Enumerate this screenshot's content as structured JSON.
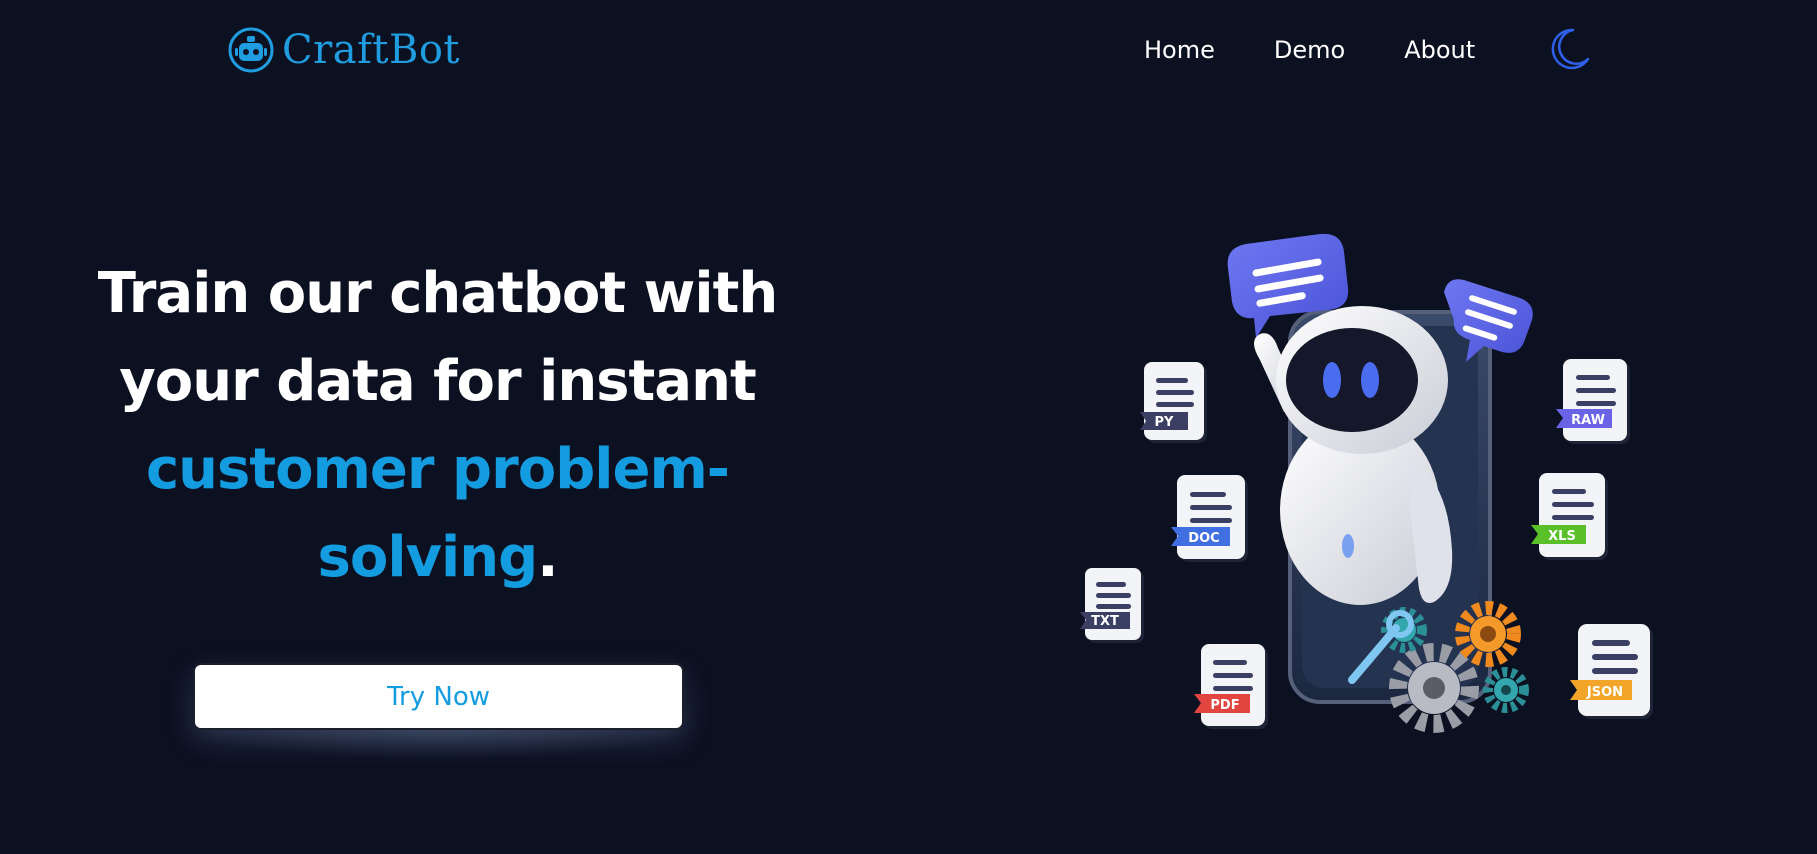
{
  "header": {
    "logo_icon": "robot-icon",
    "logo_text": "CraftBot",
    "nav": [
      {
        "label": "Home"
      },
      {
        "label": "Demo"
      },
      {
        "label": "About"
      }
    ],
    "theme_toggle_icon": "moon-icon"
  },
  "hero": {
    "title_line1": "Train our chatbot with",
    "title_line2": "your data for instant",
    "title_accent1": "customer problem-",
    "title_accent2": "solving",
    "title_period": ".",
    "cta_label": "Try Now"
  },
  "illustration": {
    "files": [
      {
        "label": "PY",
        "color": "#3a3f63"
      },
      {
        "label": "DOC",
        "color": "#3f6fe0"
      },
      {
        "label": "TXT",
        "color": "#3a3f63"
      },
      {
        "label": "PDF",
        "color": "#e2453f"
      },
      {
        "label": "RAW",
        "color": "#6b63e6"
      },
      {
        "label": "XLS",
        "color": "#59c02a"
      },
      {
        "label": "JSON",
        "color": "#f2a529"
      }
    ]
  },
  "colors": {
    "background": "#0c1121",
    "accent": "#149ce0",
    "moon": "#2f5fe8",
    "bubble": "#5b63e6"
  }
}
